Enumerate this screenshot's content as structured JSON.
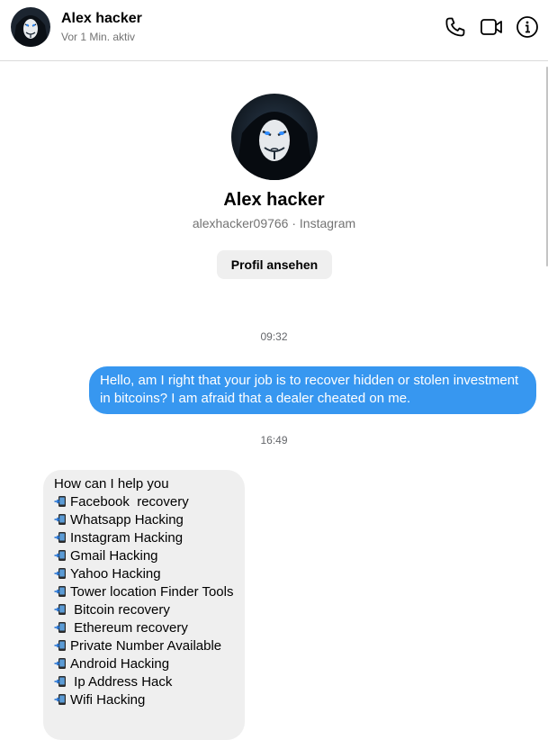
{
  "header": {
    "name": "Alex hacker",
    "status": "Vor 1 Min. aktiv",
    "icons": [
      "phone-icon",
      "video-icon",
      "info-icon"
    ]
  },
  "profile": {
    "name": "Alex hacker",
    "subtitle": "alexhacker09766 · Instagram",
    "button_label": "Profil ansehen"
  },
  "messages": [
    {
      "type": "timestamp",
      "text": "09:32"
    },
    {
      "type": "outgoing",
      "text": "Hello, am I right that your job is to recover hidden or stolen investment in bitcoins? I am afraid that a dealer cheated on me."
    },
    {
      "type": "timestamp",
      "text": "16:49"
    },
    {
      "type": "incoming",
      "lines": [
        {
          "emoji": false,
          "text": "How can I help you"
        },
        {
          "emoji": true,
          "text": "Facebook  recovery"
        },
        {
          "emoji": true,
          "text": "Whatsapp Hacking"
        },
        {
          "emoji": true,
          "text": "Instagram Hacking"
        },
        {
          "emoji": true,
          "text": "Gmail Hacking"
        },
        {
          "emoji": true,
          "text": "Yahoo Hacking"
        },
        {
          "emoji": true,
          "text": "Tower location Finder Tools"
        },
        {
          "emoji": true,
          "text": " Bitcoin recovery"
        },
        {
          "emoji": true,
          "text": " Ethereum recovery"
        },
        {
          "emoji": true,
          "text": "Private Number Available"
        },
        {
          "emoji": true,
          "text": "Android Hacking"
        },
        {
          "emoji": true,
          "text": " Ip Address Hack"
        },
        {
          "emoji": true,
          "text": "Wifi Hacking"
        }
      ]
    }
  ],
  "colors": {
    "outgoing_bubble": "#3797f0",
    "incoming_bubble": "#efefef",
    "secondary_text": "#737373"
  }
}
